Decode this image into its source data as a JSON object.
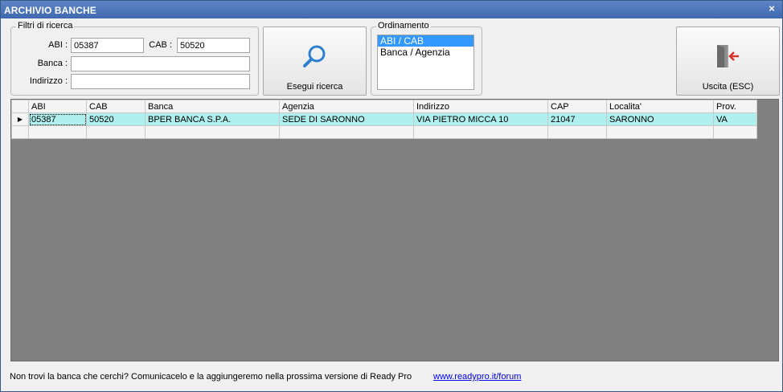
{
  "window": {
    "title": "ARCHIVIO BANCHE",
    "close_glyph": "×"
  },
  "filters": {
    "legend": "Filtri di ricerca",
    "abi_label": "ABI :",
    "abi_value": "05387",
    "cab_label": "CAB :",
    "cab_value": "50520",
    "banca_label": "Banca :",
    "banca_value": "",
    "indirizzo_label": "Indirizzo :",
    "indirizzo_value": ""
  },
  "search_button": {
    "label": "Esegui ricerca",
    "icon": "search-icon"
  },
  "ordering": {
    "legend": "Ordinamento",
    "options": [
      "ABI / CAB",
      "Banca / Agenzia"
    ],
    "selected": "ABI / CAB"
  },
  "exit_button": {
    "label": "Uscita (ESC)",
    "icon": "exit-door-icon"
  },
  "grid": {
    "columns": [
      "ABI",
      "CAB",
      "Banca",
      "Agenzia",
      "Indirizzo",
      "CAP",
      "Localita'",
      "Prov."
    ],
    "rows": [
      {
        "indicator": "▶",
        "cells": [
          "05387",
          "50520",
          "BPER BANCA S.P.A.",
          "SEDE DI SARONNO",
          "VIA PIETRO MICCA 10",
          "21047",
          "SARONNO",
          "VA"
        ]
      },
      {
        "indicator": "",
        "cells": [
          "",
          "",
          "",
          "",
          "",
          "",
          "",
          ""
        ]
      }
    ]
  },
  "footer": {
    "message": "Non trovi la banca che cerchi? Comunicacelo e la aggiungeremo nella prossima versione di Ready Pro",
    "link": "www.readypro.it/forum"
  },
  "colors": {
    "title_bar": "#4a74b8",
    "selected_row": "#aff0ee",
    "list_selection": "#3399ff",
    "grid_background": "#808080"
  }
}
